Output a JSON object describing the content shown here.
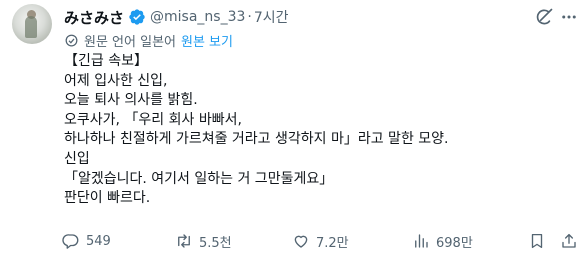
{
  "tweet": {
    "display_name": "みさみさ",
    "handle": "@misa_ns_33",
    "separator": "·",
    "time": "7시간",
    "translation_note": "원문 언어 일본어",
    "show_original": "원본 보기",
    "lines": [
      "【긴급 속보】",
      "어제 입사한 신입,",
      "오늘 퇴사 의사를 밝힘.",
      "오쿠사가, 「우리 회사 바빠서,",
      "하나하나 친절하게 가르쳐줄 거라고 생각하지 마」라고 말한 모양.",
      "신입",
      "「알겠습니다. 여기서 일하는 거 그만둘게요」",
      "판단이 빠르다."
    ]
  },
  "actions": {
    "reply_count": "549",
    "retweet_count": "5.5천",
    "like_count": "7.2만",
    "view_count": "698만"
  },
  "colors": {
    "accent": "#1d9bf0",
    "text": "#0f1419",
    "muted": "#536471"
  }
}
